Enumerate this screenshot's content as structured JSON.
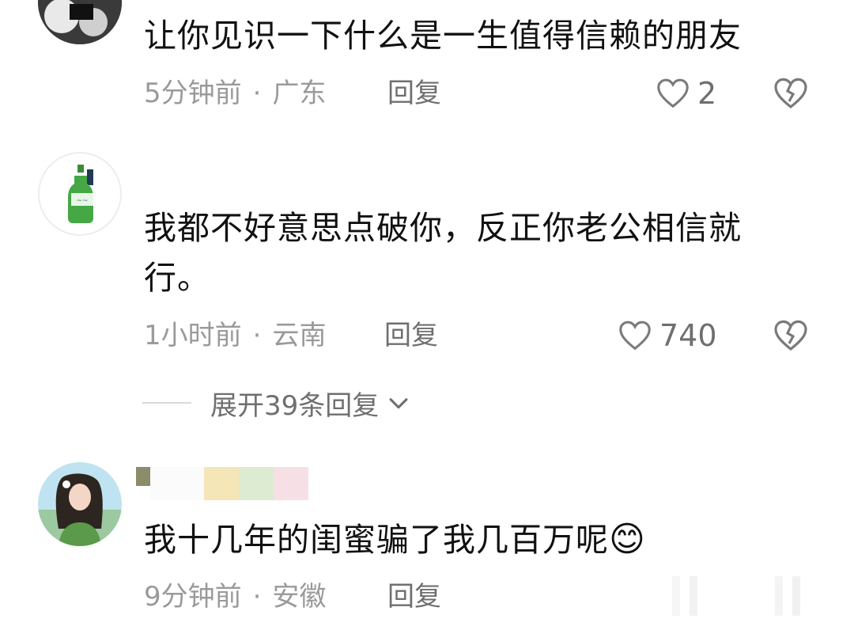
{
  "comments": [
    {
      "text": "让你见识一下什么是一生值得信赖的朋友",
      "time": "5分钟前",
      "separator": "·",
      "location": "广东",
      "reply_label": "回复",
      "likes": "2"
    },
    {
      "text": "我都不好意思点破你，反正你老公相信就行。",
      "time": "1小时前",
      "separator": "·",
      "location": "云南",
      "reply_label": "回复",
      "likes": "740"
    },
    {
      "text": "我十几年的闺蜜骗了我几百万呢",
      "emoji": "😊",
      "time": "9分钟前",
      "separator": "·",
      "location": "安徽",
      "reply_label": "回复"
    }
  ],
  "expand_replies": {
    "label": "展开39条回复"
  },
  "icons": {
    "like": "heart-outline-icon",
    "dislike": "broken-heart-icon",
    "expand": "chevron-down-icon"
  },
  "colors": {
    "text": "#111111",
    "meta": "#9a9a9a",
    "action": "#6f6f6f",
    "background": "#ffffff"
  }
}
